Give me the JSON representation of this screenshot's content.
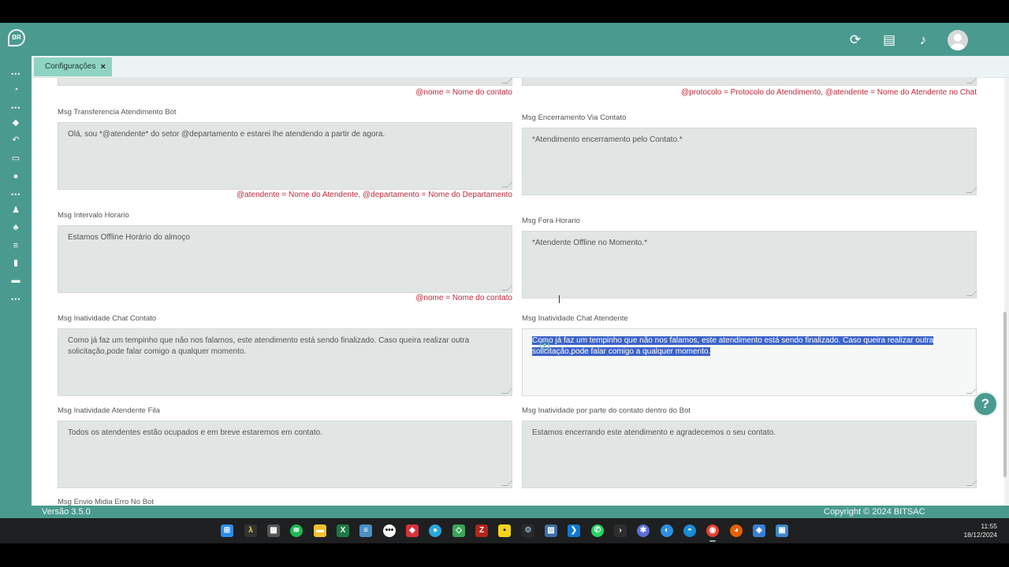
{
  "app": {
    "tab_label": "Configurações",
    "tab_close": "×",
    "version": "Versão 3.5.0",
    "copyright": "Copyright © 2024 BITSAC",
    "logo_text": "BR"
  },
  "header": {
    "icons": [
      "refresh-icon",
      "message-icon",
      "bell-icon",
      "avatar"
    ]
  },
  "sidebar": {
    "icons": [
      "logo-icon",
      "dashboard-icon",
      "tag-icon",
      "reply-icon",
      "id-card-icon",
      "user-icon",
      "users-icon",
      "sitemap-icon",
      "sliders-icon",
      "bookmark-icon",
      "card-icon"
    ],
    "dots": "•••"
  },
  "top_hints": {
    "left": "@nome = Nome do contato",
    "right": "@protocolo = Protocolo do Atendimento, @atendente = Nome do Atendente no Chat"
  },
  "fields": {
    "transferencia_bot": {
      "label": "Msg Transferencia Atendimento Bot",
      "value": "Olá, sou *@atendente* do setor @departamento e estarei lhe atendendo a partir de agora.",
      "hint": "@atendente = Nome do Atendente, @departamento = Nome do Departamento"
    },
    "encerramento_contato": {
      "label": "Msg Encerramento Via Contato",
      "value": "*Atendimento encerramento pelo Contato.*"
    },
    "intervalo_horario": {
      "label": "Msg Intervalo Horario",
      "value": "Estamos Offline Horário do almoço",
      "hint": "@nome = Nome do contato"
    },
    "fora_horario": {
      "label": "Msg Fora Horario",
      "value": "*Atendente Offline no Momento.*"
    },
    "inatividade_chat_contato": {
      "label": "Msg Inatividade Chat Contato",
      "value": "Como já faz um tempinho que não nos falamos, este atendimento está sendo finalizado. Caso queira realizar outra solicitação,pode falar comigo a qualquer momento."
    },
    "inatividade_chat_atendente": {
      "label": "Msg Inatividade Chat Atendente",
      "line1": "Como já faz um tempinho que não nos falamos, este atendimento está sendo finalizado. Caso queira realizar outra",
      "line2": "solicitação,pode falar comigo a qualquer momento."
    },
    "inatividade_atendente_fila": {
      "label": "Msg Inatividade Atendente Fila",
      "value": "Todos os atendentes estão ocupados e em breve estaremos em contato."
    },
    "inatividade_contato_bot": {
      "label": "Msg Inatividade por parte do contato dentro do Bot",
      "value": "Estamos encerrando este atendimento e agradecemos o seu contato."
    },
    "envio_midia_erro": {
      "label": "Msg Envio Midia Erro No Bot"
    }
  },
  "help_button": "?",
  "taskbar": {
    "time": "11:55",
    "date": "18/12/2024"
  }
}
